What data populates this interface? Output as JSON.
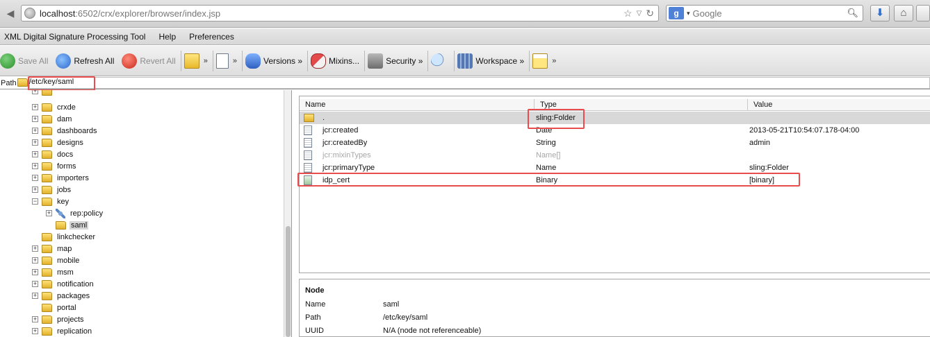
{
  "browser": {
    "url_host": "localhost",
    "url_rest": ":6502/crx/explorer/browser/index.jsp",
    "search_placeholder": "Google",
    "search_engine_letter": "g"
  },
  "menu": [
    "XML Digital Signature Processing Tool",
    "Help",
    "Preferences"
  ],
  "toolbar": {
    "save_all": "Save All",
    "refresh_all": "Refresh All",
    "revert_all": "Revert All",
    "chevron": "»",
    "versions": "Versions »",
    "mixins": "Mixins...",
    "security": "Security »",
    "workspace": "Workspace »"
  },
  "path": {
    "label": "Path",
    "value": "/etc/key/saml"
  },
  "tree": [
    {
      "label": "crxde",
      "level": 0,
      "expandable": true
    },
    {
      "label": "dam",
      "level": 0,
      "expandable": true
    },
    {
      "label": "dashboards",
      "level": 0,
      "expandable": true
    },
    {
      "label": "designs",
      "level": 0,
      "expandable": true
    },
    {
      "label": "docs",
      "level": 0,
      "expandable": true
    },
    {
      "label": "forms",
      "level": 0,
      "expandable": true
    },
    {
      "label": "importers",
      "level": 0,
      "expandable": true
    },
    {
      "label": "jobs",
      "level": 0,
      "expandable": true
    },
    {
      "label": "key",
      "level": 0,
      "expandable": true,
      "expanded": true
    },
    {
      "label": "rep:policy",
      "level": 1,
      "expandable": true,
      "icon": "policy-icon"
    },
    {
      "label": "saml",
      "level": 1,
      "expandable": false,
      "selected": true
    },
    {
      "label": "linkchecker",
      "level": 0,
      "expandable": false
    },
    {
      "label": "map",
      "level": 0,
      "expandable": true
    },
    {
      "label": "mobile",
      "level": 0,
      "expandable": true
    },
    {
      "label": "msm",
      "level": 0,
      "expandable": true
    },
    {
      "label": "notification",
      "level": 0,
      "expandable": true
    },
    {
      "label": "packages",
      "level": 0,
      "expandable": true
    },
    {
      "label": "portal",
      "level": 0,
      "expandable": false
    },
    {
      "label": "projects",
      "level": 0,
      "expandable": true
    },
    {
      "label": "replication",
      "level": 0,
      "expandable": true
    }
  ],
  "properties": {
    "columns": [
      "Name",
      "Type",
      "Value"
    ],
    "rows": [
      {
        "name": ".",
        "type": "sling:Folder",
        "value": "",
        "icon": "folder-icon",
        "selected": true
      },
      {
        "name": "jcr:created",
        "type": "Date",
        "value": "2013-05-21T10:54:07.178-04:00",
        "icon": "property-icon"
      },
      {
        "name": "jcr:createdBy",
        "type": "String",
        "value": "admin",
        "icon": "property-icon"
      },
      {
        "name": "jcr:mixinTypes",
        "type": "Name[]",
        "value": "",
        "icon": "property-icon",
        "dim": true
      },
      {
        "name": "jcr:primaryType",
        "type": "Name",
        "value": "sling:Folder",
        "icon": "property-icon"
      },
      {
        "name": "idp_cert",
        "type": "Binary",
        "value": "[binary]",
        "icon": "binary-icon"
      }
    ]
  },
  "node_info": {
    "title": "Node",
    "rows": [
      {
        "key": "Name",
        "value": "saml"
      },
      {
        "key": "Path",
        "value": "/etc/key/saml"
      },
      {
        "key": "UUID",
        "value": "N/A (node not referenceable)"
      }
    ]
  },
  "colors": {
    "highlight": "#e84c4c",
    "selection": "#d8d8d8"
  }
}
